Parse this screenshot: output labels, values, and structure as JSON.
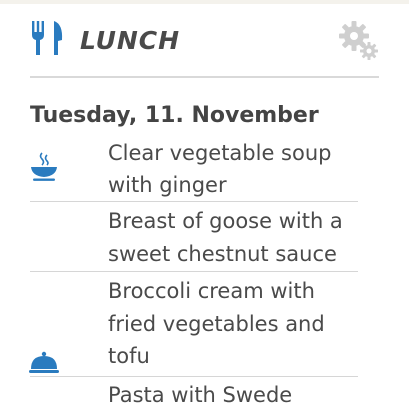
{
  "app": {
    "title": "LUNCH"
  },
  "icons": {
    "cutlery": "cutlery-icon",
    "settings": "gear-icon",
    "soup": "soup-bowl-icon",
    "cloche": "serving-cloche-icon"
  },
  "colors": {
    "accent": "#2a7bbf",
    "text": "#4a4a4a",
    "gear": "#cfcfcf",
    "rule": "#d9d9d9"
  },
  "day": {
    "heading": "Tuesday, 11. November"
  },
  "menu": {
    "items": [
      {
        "lines": [
          "Clear vegetable soup",
          "with ginger"
        ]
      },
      {
        "lines": [
          "Breast of goose with a",
          "sweet chestnut sauce"
        ]
      },
      {
        "lines": [
          "Broccoli cream with",
          "fried vegetables and",
          "tofu"
        ]
      },
      {
        "lines": [
          "Pasta with Swede"
        ]
      }
    ]
  }
}
